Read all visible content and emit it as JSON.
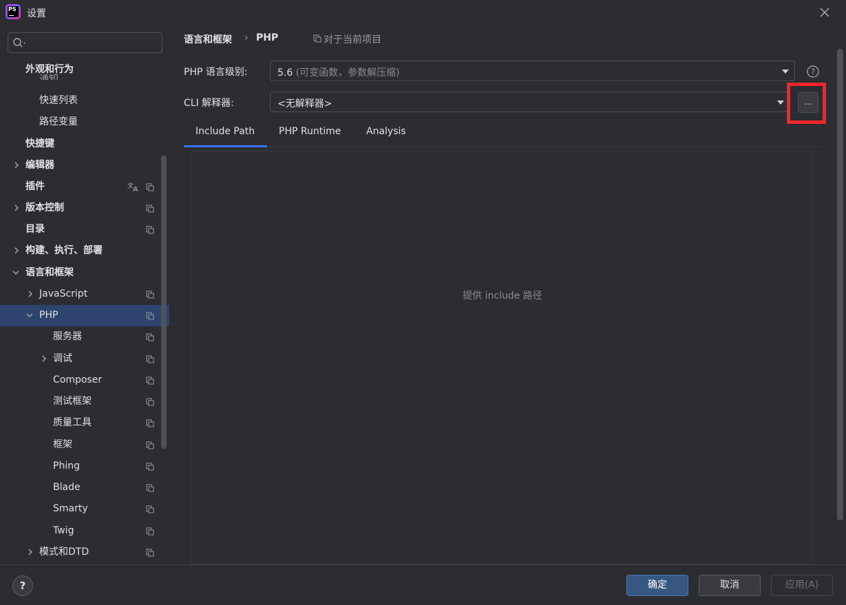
{
  "window": {
    "title": "设置",
    "logo_text": "PS"
  },
  "search": {
    "placeholder": ""
  },
  "sidebar": {
    "partial_item": "通知",
    "items": [
      {
        "label": "外观和行为",
        "bold": true
      },
      {
        "label": "快速列表"
      },
      {
        "label": "路径变量"
      },
      {
        "label": "快捷键",
        "bold": true
      },
      {
        "label": "编辑器",
        "bold": true
      },
      {
        "label": "插件",
        "bold": true
      },
      {
        "label": "版本控制",
        "bold": true
      },
      {
        "label": "目录",
        "bold": true
      },
      {
        "label": "构建、执行、部署",
        "bold": true
      },
      {
        "label": "语言和框架",
        "bold": true
      },
      {
        "label": "JavaScript"
      },
      {
        "label": "PHP"
      },
      {
        "label": "服务器"
      },
      {
        "label": "调试"
      },
      {
        "label": "Composer"
      },
      {
        "label": "测试框架"
      },
      {
        "label": "质量工具"
      },
      {
        "label": "框架"
      },
      {
        "label": "Phing"
      },
      {
        "label": "Blade"
      },
      {
        "label": "Smarty"
      },
      {
        "label": "Twig"
      },
      {
        "label": "模式和DTD"
      }
    ]
  },
  "breadcrumb": {
    "parent": "语言和框架",
    "separator": "›",
    "current": "PHP",
    "scope": "对于当前项目"
  },
  "php_level": {
    "label": "PHP 语言级别:",
    "value": "5.6",
    "hint": "(可变函数，参数解压缩)"
  },
  "cli": {
    "label": "CLI 解释器:",
    "value": "<无解释器>",
    "browse": "..."
  },
  "tabs": [
    "Include Path",
    "PHP Runtime",
    "Analysis"
  ],
  "active_tab": "Include Path",
  "content": {
    "empty_text": "提供 include 路径"
  },
  "footer": {
    "help": "?",
    "ok": "确定",
    "cancel": "取消",
    "apply": "应用(A)"
  },
  "colors": {
    "accent": "#3574f0",
    "selection": "#2e436e",
    "highlight": "#f0252b",
    "ok_button": "#365880"
  }
}
